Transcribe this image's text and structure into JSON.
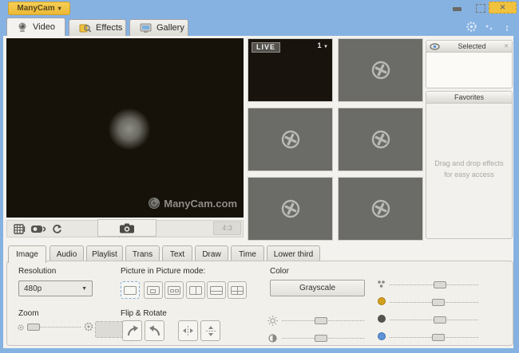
{
  "window": {
    "app_button_label": "ManyCam",
    "app_button_caret": "▾",
    "close_glyph": "✕"
  },
  "main_tabs": [
    {
      "label": "Video"
    },
    {
      "label": "Effects"
    },
    {
      "label": "Gallery"
    }
  ],
  "preview": {
    "watermark": "ManyCam.com",
    "aspect_button": "4:3",
    "grip": "···"
  },
  "live": {
    "badge": "LIVE",
    "source_number": "1",
    "caret": "▼"
  },
  "right_panel": {
    "selected_title": "Selected",
    "close_glyph": "✕",
    "favorites_title": "Favorites",
    "hint_line1": "Drag and drop effects",
    "hint_line2": "for easy access"
  },
  "bottom_tabs": [
    "Image",
    "Audio",
    "Playlist",
    "Trans",
    "Text",
    "Draw",
    "Time",
    "Lower third"
  ],
  "image_tab": {
    "resolution_label": "Resolution",
    "resolution_value": "480p",
    "pip_label": "Picture in Picture mode:",
    "color_label": "Color",
    "grayscale_button": "Grayscale",
    "zoom_label": "Zoom",
    "flip_label": "Flip & Rotate",
    "sliders": {
      "zoom": 10,
      "brightness": 48,
      "contrast": 48,
      "saturation": 57,
      "hue": 55,
      "black_level": 57,
      "blue_level": 55
    }
  },
  "colors": {
    "titlebar_blue": "#86b2e2",
    "accent_yellow": "#f0c23d",
    "live_dark": "#171209",
    "thumb_gray": "#6b6b67",
    "panel_bg": "#f2f0ea",
    "pip_selected_border": "#7fabd9",
    "hue_dot": "#d4a01c",
    "black_dot": "#55534f",
    "blue_dot": "#5e93d8"
  }
}
